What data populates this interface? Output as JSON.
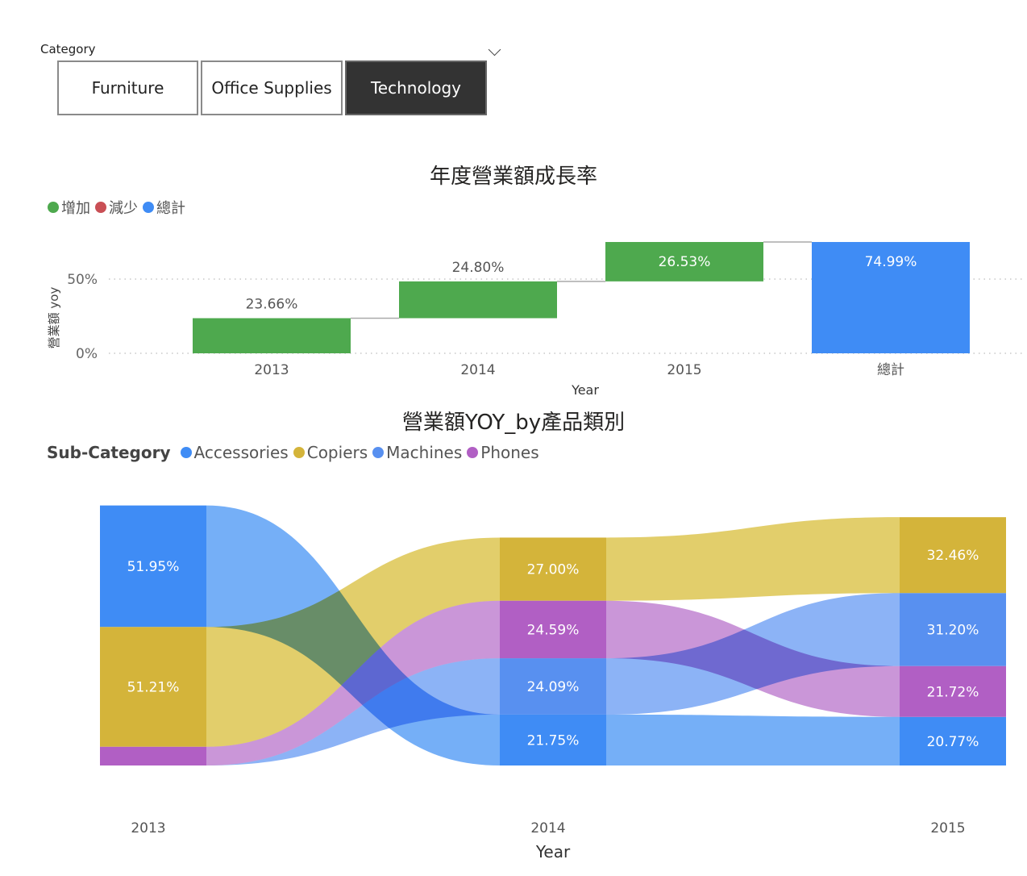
{
  "slicer": {
    "title": "Category",
    "options": [
      "Furniture",
      "Office Supplies",
      "Technology"
    ],
    "selected": "Technology"
  },
  "waterfall": {
    "title": "年度營業額成長率",
    "legend": [
      {
        "label": "增加",
        "color": "#4EA94E"
      },
      {
        "label": "減少",
        "color": "#C94F55"
      },
      {
        "label": "總計",
        "color": "#3F8CF5"
      }
    ]
  },
  "ribbon": {
    "title": "營業額YOY_by產品類別",
    "legend_title": "Sub-Category",
    "legend": [
      {
        "label": "Accessories",
        "color": "#3F8CF5"
      },
      {
        "label": "Copiers",
        "color": "#D4B43A"
      },
      {
        "label": "Machines",
        "color": "#5890F0"
      },
      {
        "label": "Phones",
        "color": "#B15FC4"
      }
    ]
  },
  "chart_data": [
    {
      "type": "bar",
      "subtype": "waterfall",
      "title": "年度營業額成長率",
      "xlabel": "Year",
      "ylabel": "營業額 yoy",
      "categories": [
        "2013",
        "2014",
        "2015",
        "總計"
      ],
      "values": [
        23.66,
        24.8,
        26.53,
        74.99
      ],
      "labels": [
        "23.66%",
        "24.80%",
        "26.53%",
        "74.99%"
      ],
      "value_kind": [
        "increase",
        "increase",
        "increase",
        "total"
      ],
      "yticks": [
        "0%",
        "50%"
      ],
      "ylim": [
        0,
        85
      ],
      "grid": true,
      "legend": [
        "增加",
        "減少",
        "總計"
      ],
      "legend_position": "top-left"
    },
    {
      "type": "ribbon",
      "title": "營業額YOY_by產品類別",
      "xlabel": "Year",
      "legend_title": "Sub-Category",
      "legend_position": "top-left",
      "categories": [
        "2013",
        "2014",
        "2015"
      ],
      "series": [
        {
          "name": "Accessories",
          "color": "#3F8CF5",
          "values": [
            51.95,
            21.75,
            20.77
          ],
          "labels": [
            "51.95%",
            "21.75%",
            "20.77%"
          ]
        },
        {
          "name": "Copiers",
          "color": "#D4B43A",
          "values": [
            51.21,
            27.0,
            32.46
          ],
          "labels": [
            "51.21%",
            "27.00%",
            "32.46%"
          ]
        },
        {
          "name": "Machines",
          "color": "#5890F0",
          "values": [
            0,
            24.09,
            31.2
          ],
          "labels": [
            "",
            "24.09%",
            "31.20%"
          ]
        },
        {
          "name": "Phones",
          "color": "#B15FC4",
          "values": [
            8,
            24.59,
            21.72
          ],
          "labels": [
            "",
            "24.59%",
            "21.72%"
          ]
        }
      ]
    }
  ]
}
